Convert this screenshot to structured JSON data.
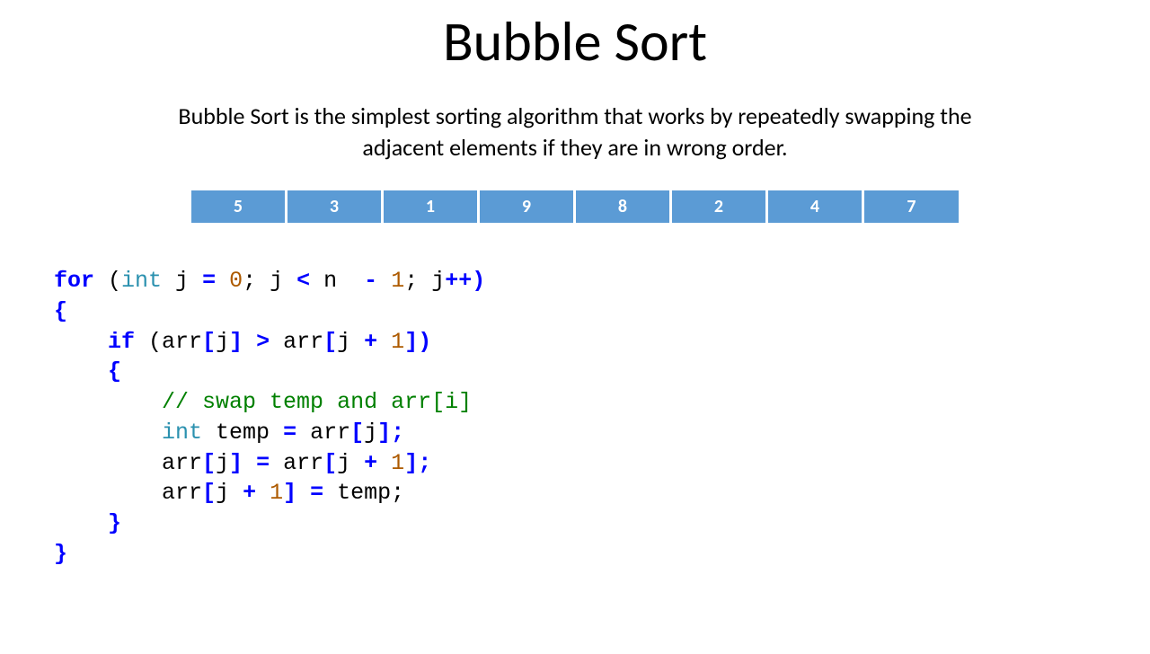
{
  "title": "Bubble Sort",
  "description": "Bubble Sort is the simplest sorting algorithm that works by repeatedly swapping the adjacent elements if they are in wrong order.",
  "array": [
    "5",
    "3",
    "1",
    "9",
    "8",
    "2",
    "4",
    "7"
  ],
  "code": {
    "line1_for": "for",
    "line1_open": " (",
    "line1_int": "int",
    "line1_j_eq": " j ",
    "line1_eq": "=",
    "line1_sp": " ",
    "line1_zero": "0",
    "line1_semi1": "; j ",
    "line1_lt": "<",
    "line1_n": " n  ",
    "line1_minus": "-",
    "line1_sp2": " ",
    "line1_one": "1",
    "line1_semi2": "; j",
    "line1_pp": "++)",
    "line2": "{",
    "line3_if": "if",
    "line3_rest1": " (arr",
    "line3_b1": "[",
    "line3_j1": "j",
    "line3_b2": "] >",
    "line3_rest2": " arr",
    "line3_b3": "[",
    "line3_j2": "j ",
    "line3_plus": "+",
    "line3_sp": " ",
    "line3_one": "1",
    "line3_b4": "])",
    "line4": "{",
    "line5_comment": "// swap temp and arr[i]",
    "line6_int": "int",
    "line6_rest": " temp ",
    "line6_eq": "=",
    "line6_rest2": " arr",
    "line6_b1": "[",
    "line6_j": "j",
    "line6_b2": "];",
    "line7_a": "arr",
    "line7_b1": "[",
    "line7_j1": "j",
    "line7_b2": "] =",
    "line7_rest": " arr",
    "line7_b3": "[",
    "line7_j2": "j ",
    "line7_plus": "+",
    "line7_sp": " ",
    "line7_one": "1",
    "line7_b4": "];",
    "line8_a": "arr",
    "line8_b1": "[",
    "line8_j": "j ",
    "line8_plus": "+",
    "line8_sp": " ",
    "line8_one": "1",
    "line8_b2": "] =",
    "line8_rest": " temp;",
    "line9": "}",
    "line10": "}"
  }
}
